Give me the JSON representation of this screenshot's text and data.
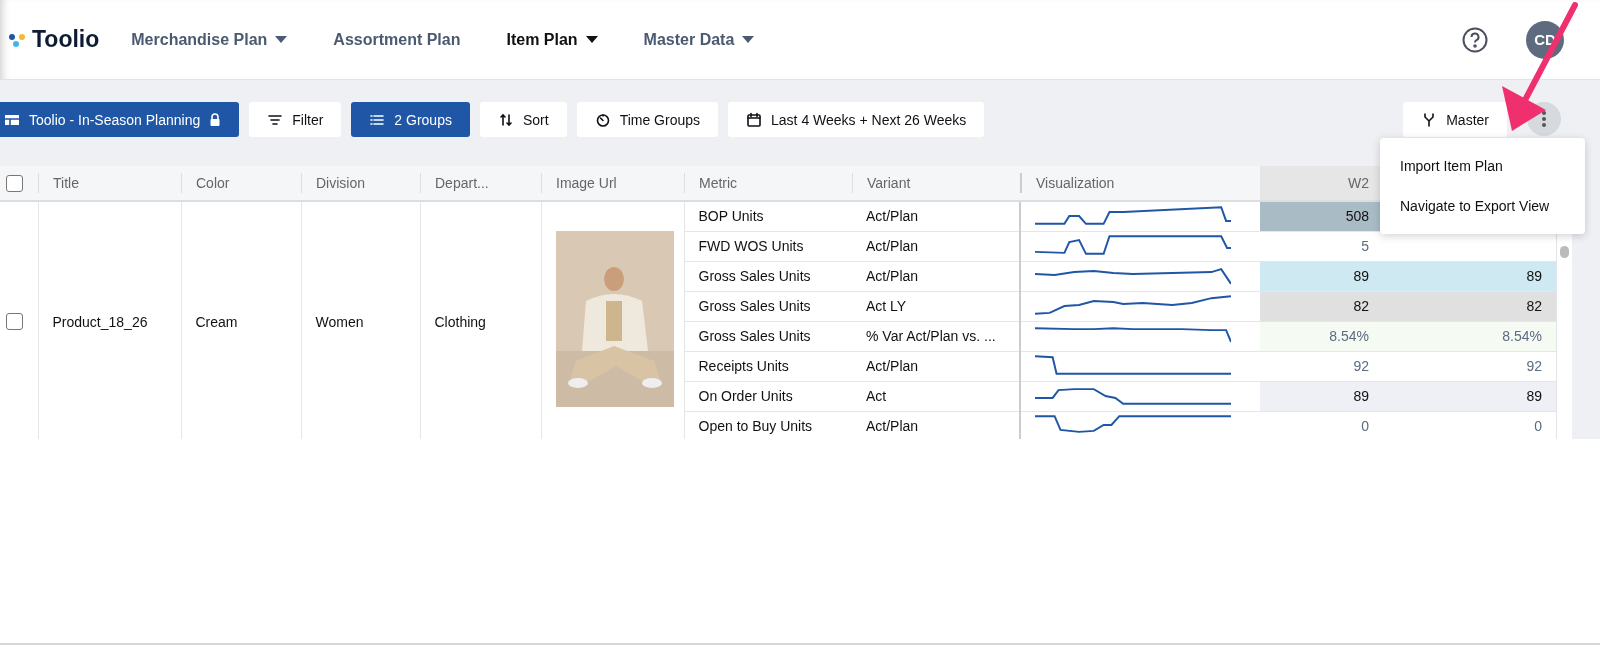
{
  "nav": {
    "brand": "Toolio",
    "items": [
      {
        "label": "Merchandise Plan",
        "has_menu": true,
        "selected": false
      },
      {
        "label": "Assortment Plan",
        "has_menu": false,
        "selected": false
      },
      {
        "label": "Item Plan",
        "has_menu": true,
        "selected": true
      },
      {
        "label": "Master Data",
        "has_menu": true,
        "selected": false
      }
    ],
    "avatar": "CD"
  },
  "toolbar": {
    "buttons": [
      {
        "kind": "plan",
        "label": "Toolio - In-Season Planning",
        "selected": true
      },
      {
        "kind": "filter",
        "label": "Filter",
        "selected": false
      },
      {
        "kind": "groups",
        "label": "2 Groups",
        "selected": true
      },
      {
        "kind": "sort",
        "label": "Sort",
        "selected": false
      },
      {
        "kind": "time",
        "label": "Time Groups",
        "selected": false
      },
      {
        "kind": "calendar",
        "label": "Last 4 Weeks + Next 26 Weeks",
        "selected": false
      }
    ],
    "branch": "Master",
    "more_open": true
  },
  "menu": {
    "items": [
      "Import Item Plan",
      "Navigate to Export View"
    ]
  },
  "table": {
    "columns": [
      "Title",
      "Color",
      "Division",
      "Depart...",
      "Image Url",
      "Metric",
      "Variant",
      "Visualization",
      "W2"
    ],
    "header_checked": false,
    "product": {
      "checked": false,
      "title": "Product_18_26",
      "product_color": "Cream",
      "division": "Women",
      "department": "Clothing"
    },
    "rows": [
      {
        "metric": "BOP Units",
        "variant": "Act/Plan",
        "color": "#a9bcc6",
        "muted": false,
        "values": [
          "508"
        ]
      },
      {
        "metric": "FWD WOS Units",
        "variant": "Act/Plan",
        "color": "#ffffff",
        "muted": true,
        "values": [
          "5"
        ]
      },
      {
        "metric": "Gross Sales Units",
        "variant": "Act/Plan",
        "color": "#cfe9f2",
        "muted": false,
        "values": [
          "89",
          "89"
        ]
      },
      {
        "metric": "Gross Sales Units",
        "variant": "Act LY",
        "color": "#e0e0e0",
        "muted": false,
        "values": [
          "82",
          "82"
        ]
      },
      {
        "metric": "Gross Sales Units",
        "variant": "% Var Act/Plan vs. ...",
        "color": "#f5faf3",
        "muted": true,
        "values": [
          "8.54%",
          "8.54%"
        ]
      },
      {
        "metric": "Receipts Units",
        "variant": "Act/Plan",
        "color": "#ffffff",
        "muted": true,
        "values": [
          "92",
          "92"
        ]
      },
      {
        "metric": "On Order Units",
        "variant": "Act",
        "color": "#eef0f5",
        "muted": false,
        "values": [
          "89",
          "89"
        ]
      },
      {
        "metric": "Open to Buy Units",
        "variant": "Act/Plan",
        "color": "#ffffff",
        "muted": true,
        "values": [
          "0",
          "0"
        ]
      }
    ]
  }
}
